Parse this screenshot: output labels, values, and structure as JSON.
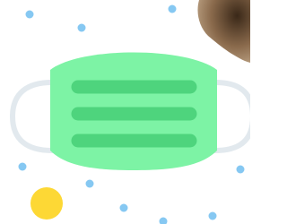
{
  "illustration": {
    "subject": "face-mask-icon",
    "colors": {
      "mask_body": "#7df3a5",
      "mask_pleats": "#4ed47d",
      "ear_loops": "#e2e9ee",
      "dots": "#86c8f2",
      "yellow_circle": "#fdd835",
      "photo_corner_dark": "#3a2818",
      "photo_corner_mid": "#8a6a4c",
      "photo_corner_light": "#c4ab8d"
    },
    "pleat_count": 3
  }
}
